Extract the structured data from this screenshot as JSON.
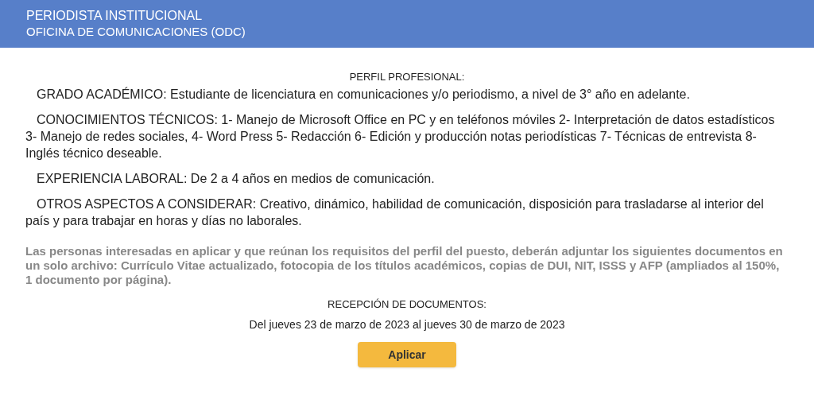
{
  "header": {
    "title": "PERIODISTA INSTITUCIONAL",
    "subtitle": "OFICINA DE COMUNICACIONES (ODC)"
  },
  "profile": {
    "heading": "PERFIL PROFESIONAL:",
    "paragraphs": [
      "GRADO ACADÉMICO: Estudiante de licenciatura en comunicaciones y/o periodismo, a nivel de 3° año en adelante.",
      "CONOCIMIENTOS TÉCNICOS: 1- Manejo de Microsoft Office en PC y en teléfonos móviles 2- Interpretación de datos estadísticos 3- Manejo de redes sociales, 4- Word Press 5- Redacción 6- Edición y producción notas periodísticas 7- Técnicas de entrevista 8- Inglés técnico deseable.",
      "EXPERIENCIA LABORAL: De 2 a 4 años en medios de comunicación.",
      "OTROS ASPECTOS A CONSIDERAR: Creativo, dinámico, habilidad de comunicación, disposición para trasladarse al interior del país y para trabajar en horas y días no laborales."
    ]
  },
  "notice": "Las personas interesadas en aplicar y que reúnan los requisitos del perfil del puesto, deberán adjuntar los siguientes documentos en un solo archivo: Currículo Vitae actualizado, fotocopia de los títulos académicos, copias de DUI, NIT, ISSS y AFP (ampliados al 150%, 1 documento por página).",
  "reception": {
    "heading": "RECEPCIÓN DE DOCUMENTOS:",
    "dates": "Del jueves 23 de marzo de 2023 al jueves 30 de marzo de 2023"
  },
  "button": "Aplicar"
}
